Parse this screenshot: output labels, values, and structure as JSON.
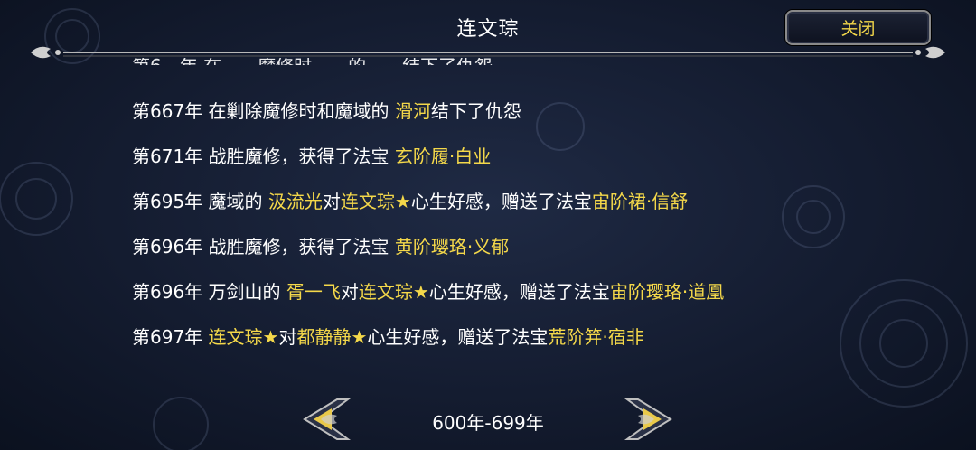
{
  "header": {
    "title": "连文琮",
    "close_label": "关闭"
  },
  "log": {
    "partial_line": "第6…年 在……魔修时……的……结下了仇怨",
    "entries": [
      {
        "year": "第667年",
        "segments": [
          {
            "text": " 在剿除魔修时和魔域的 ",
            "hl": false
          },
          {
            "text": "滑河",
            "hl": true
          },
          {
            "text": "结下了仇怨",
            "hl": false
          }
        ]
      },
      {
        "year": "第671年",
        "segments": [
          {
            "text": " 战胜魔修，获得了法宝 ",
            "hl": false
          },
          {
            "text": "玄阶履·白业",
            "hl": true
          }
        ]
      },
      {
        "year": "第695年",
        "segments": [
          {
            "text": " 魔域的 ",
            "hl": false
          },
          {
            "text": "汲流光",
            "hl": true
          },
          {
            "text": "对",
            "hl": false
          },
          {
            "text": "连文琮★",
            "hl": true
          },
          {
            "text": "心生好感，赠送了法宝",
            "hl": false
          },
          {
            "text": "宙阶裙·信舒",
            "hl": true
          }
        ]
      },
      {
        "year": "第696年",
        "segments": [
          {
            "text": " 战胜魔修，获得了法宝 ",
            "hl": false
          },
          {
            "text": "黄阶璎珞·义郁",
            "hl": true
          }
        ]
      },
      {
        "year": "第696年",
        "segments": [
          {
            "text": " 万剑山的 ",
            "hl": false
          },
          {
            "text": "胥一飞",
            "hl": true
          },
          {
            "text": "对",
            "hl": false
          },
          {
            "text": "连文琮★",
            "hl": true
          },
          {
            "text": "心生好感，赠送了法宝",
            "hl": false
          },
          {
            "text": "宙阶璎珞·道凰",
            "hl": true
          }
        ]
      },
      {
        "year": "第697年",
        "segments": [
          {
            "text": " ",
            "hl": false
          },
          {
            "text": "连文琮★",
            "hl": true
          },
          {
            "text": "对",
            "hl": false
          },
          {
            "text": "都静静★",
            "hl": true
          },
          {
            "text": "心生好感，赠送了法宝",
            "hl": false
          },
          {
            "text": "荒阶笄·宿非",
            "hl": true
          }
        ]
      }
    ]
  },
  "pager": {
    "range_label": "600年-699年",
    "prev_icon": "left-arrow-icon",
    "next_icon": "right-arrow-icon"
  },
  "colors": {
    "highlight": "#f4d84a",
    "text": "#ffffff",
    "background": "#141c30"
  }
}
